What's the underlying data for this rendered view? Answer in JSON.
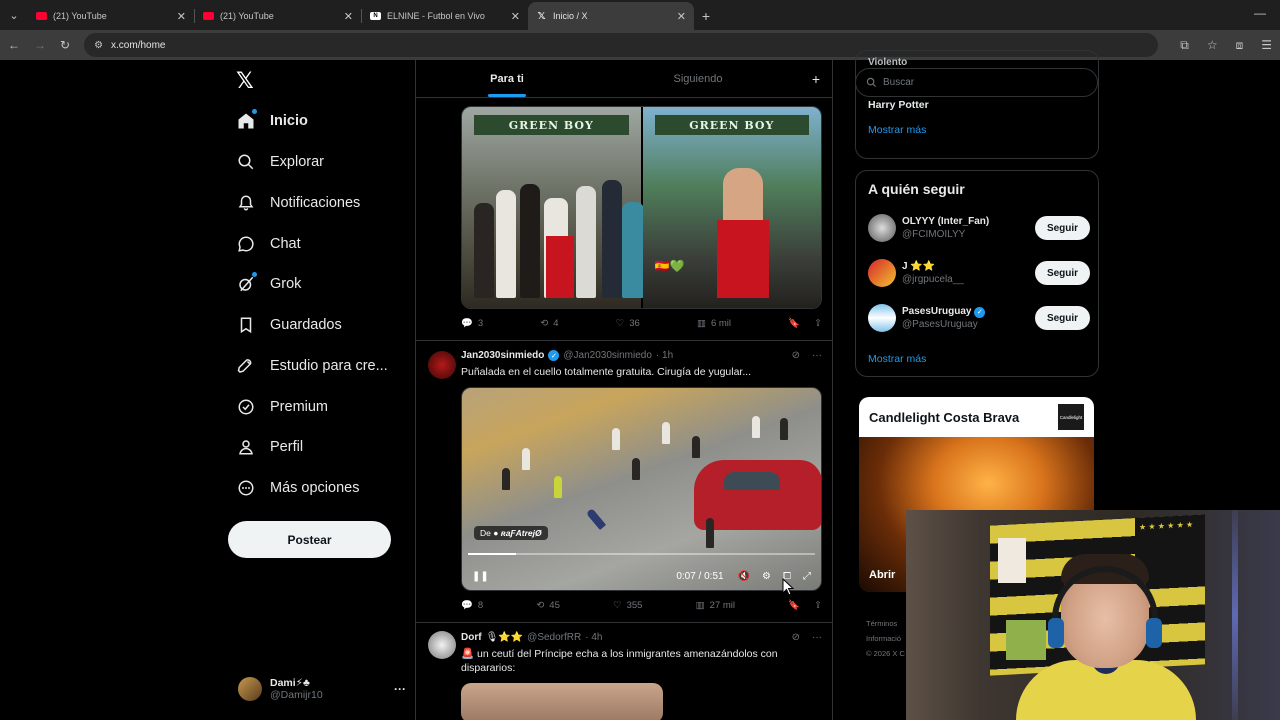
{
  "browser": {
    "tabs": [
      {
        "title": "(21) YouTube",
        "icon": "youtube-icon"
      },
      {
        "title": "(21) YouTube",
        "icon": "youtube-icon"
      },
      {
        "title": "ELNINE - Futbol en Vivo",
        "icon": "elnine-icon"
      },
      {
        "title": "Inicio / X",
        "icon": "x-icon",
        "active": true
      }
    ],
    "url": "x.com/home"
  },
  "nav": {
    "items": [
      {
        "label": "Inicio",
        "icon": "home-icon",
        "active": true
      },
      {
        "label": "Explorar",
        "icon": "search-icon"
      },
      {
        "label": "Notificaciones",
        "icon": "bell-icon"
      },
      {
        "label": "Chat",
        "icon": "chat-icon"
      },
      {
        "label": "Grok",
        "icon": "grok-icon"
      },
      {
        "label": "Guardados",
        "icon": "bookmark-icon"
      },
      {
        "label": "Estudio para cre...",
        "icon": "rocket-icon"
      },
      {
        "label": "Premium",
        "icon": "premium-icon"
      },
      {
        "label": "Perfil",
        "icon": "person-icon"
      },
      {
        "label": "Más opciones",
        "icon": "more-circle-icon"
      }
    ],
    "post_button": "Postear",
    "account": {
      "name": "Dami⚡♣",
      "handle": "@Damijr10"
    }
  },
  "feed": {
    "tabs": [
      "Para ti",
      "Siguiendo"
    ],
    "post1": {
      "banner_left": "GREEN BOY",
      "banner_right": "GREEN BOY",
      "flag": "🇪🇸💚",
      "replies": "3",
      "reposts": "4",
      "likes": "36",
      "views": "6 mil"
    },
    "post2": {
      "name": "Jan2030sinmiedo",
      "handle": "@Jan2030sinmiedo",
      "time": "· 1h",
      "text": "Puñalada en el cuello totalmente gratuita. Cirugía de yugular...",
      "video_source_prefix": "De",
      "video_source": "ʀaƑAtrejØ",
      "video_time": "0:07 / 0:51",
      "video_progress": 0.137,
      "replies": "8",
      "reposts": "45",
      "likes": "355",
      "views": "27 mil"
    },
    "post3": {
      "name": "Dorf",
      "badges": "🎙⭐⭐",
      "handle": "@SedorfRR",
      "time": "· 4h",
      "text": "🚨 un ceutí del Príncipe echa a los inmigrantes amenazándolos con dispararios:"
    }
  },
  "sidebar": {
    "search_placeholder": "Buscar",
    "trend_cut": "Violento",
    "trend_item": "Harry Potter",
    "show_more": "Mostrar más",
    "who_to_follow_title": "A quién seguir",
    "suggestions": [
      {
        "name": "OLYYY (Inter_Fan)",
        "handle": "@FCIMOILYY",
        "button": "Seguir"
      },
      {
        "name": "J ⭐⭐",
        "handle": "@jrgpucela__",
        "button": "Seguir"
      },
      {
        "name": "PasesUruguay",
        "handle": "@PasesUruguay",
        "button": "Seguir",
        "verified": true
      }
    ],
    "show_more_2": "Mostrar más",
    "ad": {
      "title": "Candlelight Costa Brava",
      "logo": "Candlelight",
      "button": "Abrir"
    },
    "footer": [
      "Términos",
      "Informació",
      "© 2026 X C"
    ]
  },
  "webcam": {
    "flag_text": "★ ★ ★ ★ ★ ★"
  },
  "colors": {
    "accent": "#1d9bf0",
    "background": "#000000",
    "border": "#2f3336",
    "muted": "#71767b"
  }
}
